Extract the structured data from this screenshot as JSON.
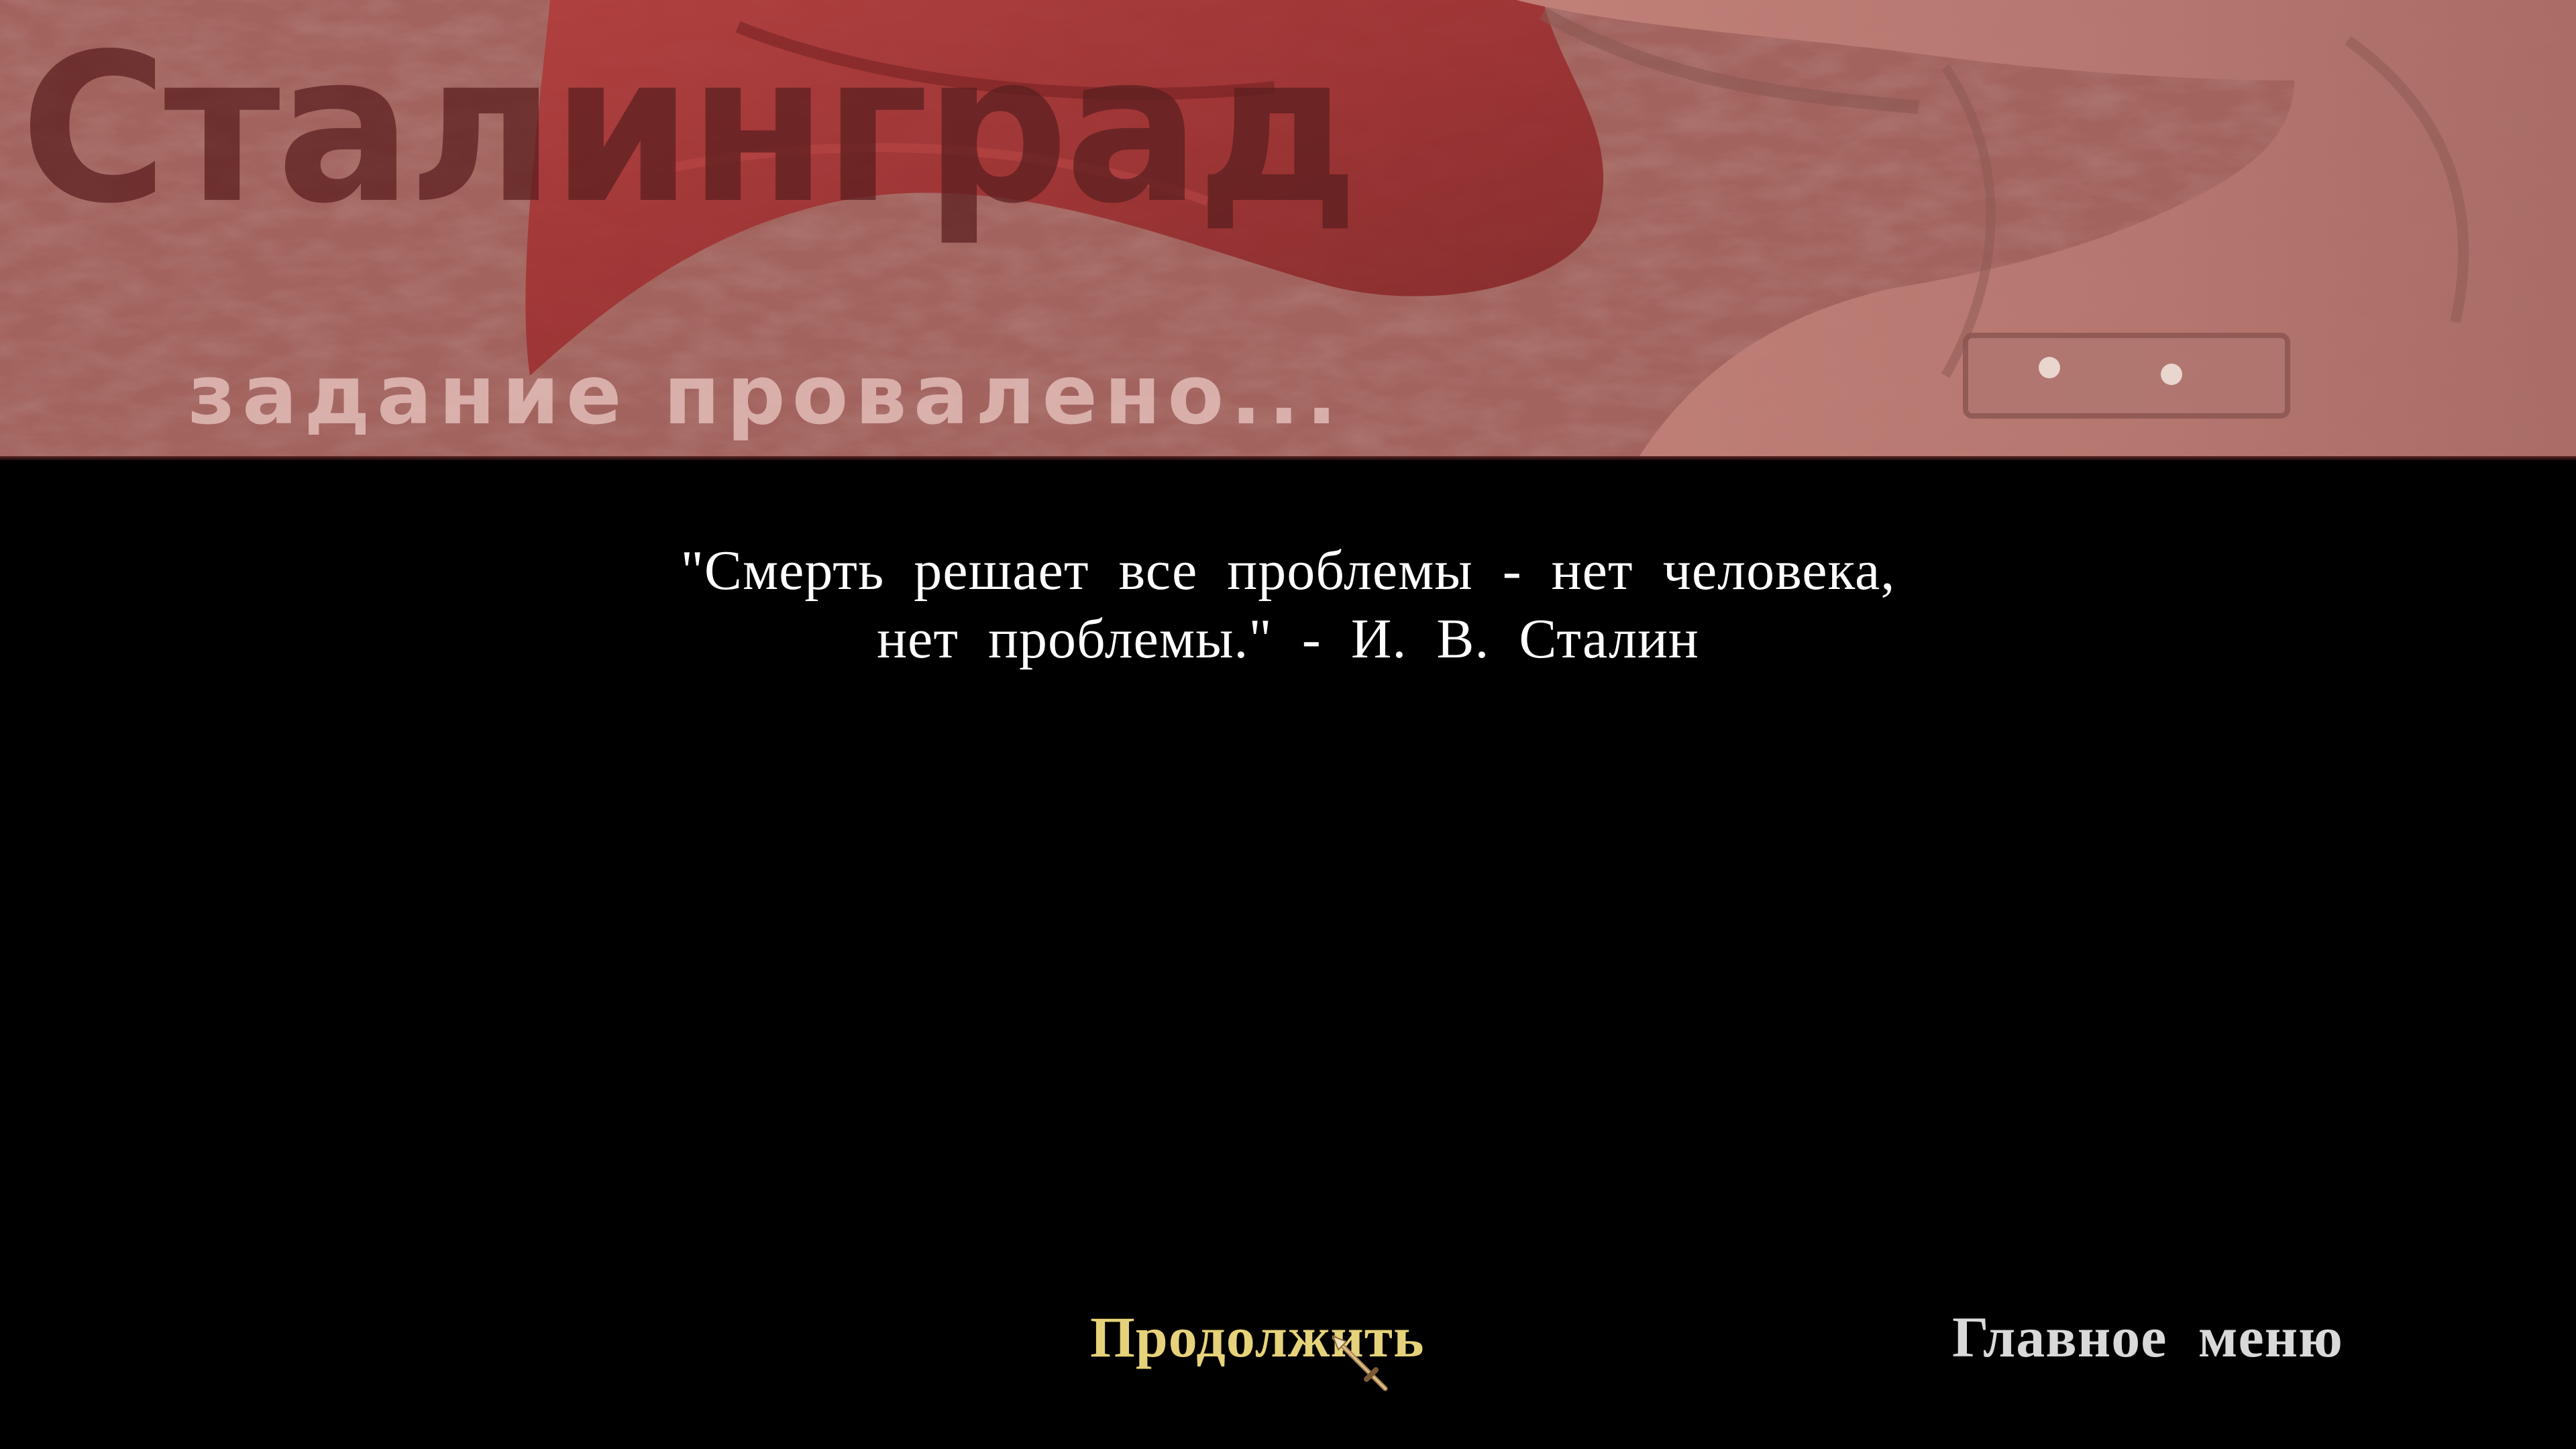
{
  "banner": {
    "title": "Сталинград",
    "subtitle": "задание провалено..."
  },
  "quote": {
    "line1": "\"Смерть решает все проблемы - нет человека,",
    "line2": "нет проблемы.\" - И. В. Сталин"
  },
  "menu": {
    "continue_label": "Продолжить",
    "main_menu_label": "Главное меню",
    "continue_state": "hovered"
  },
  "colors": {
    "banner_tint": "#a86a65",
    "title_text": "#5a1e1e",
    "subtitle_text": "#e8c4bf",
    "quote_text": "#ffffff",
    "continue_text": "#e6d27a",
    "main_menu_text": "#d9d9d9",
    "background": "#000000"
  },
  "icons": {
    "cursor": "sword-cursor-icon"
  }
}
